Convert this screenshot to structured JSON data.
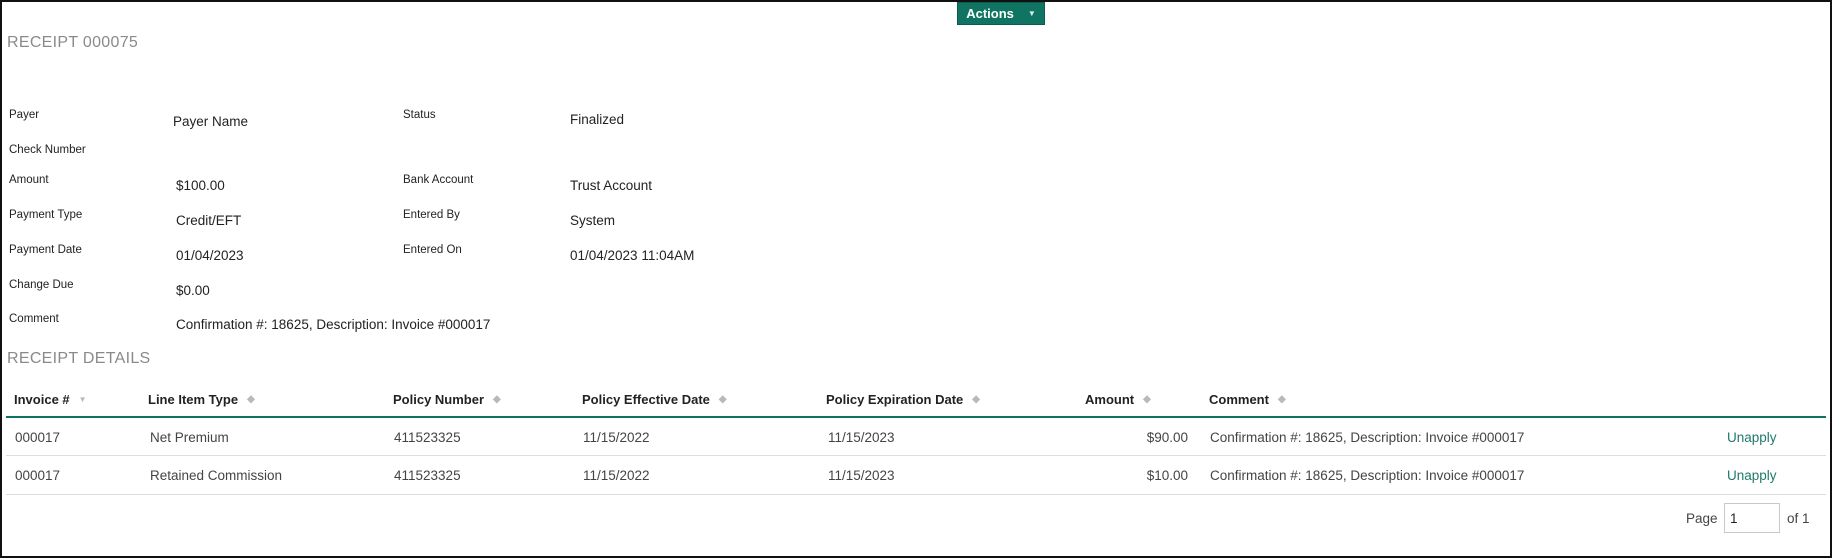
{
  "header": {
    "receipt_title": "RECEIPT 000075",
    "actions_label": "Actions",
    "actions_caret": "▼",
    "accent_color": "#0f7562"
  },
  "fields": {
    "payer_label": "Payer",
    "payer_value": "Payer Name",
    "status_label": "Status",
    "status_value": "Finalized",
    "check_number_label": "Check Number",
    "check_number_value": "",
    "amount_label": "Amount",
    "amount_value": "$100.00",
    "bank_account_label": "Bank Account",
    "bank_account_value": "Trust Account",
    "payment_type_label": "Payment Type",
    "payment_type_value": "Credit/EFT",
    "entered_by_label": "Entered By",
    "entered_by_value": "System",
    "payment_date_label": "Payment Date",
    "payment_date_value": "01/04/2023",
    "entered_on_label": "Entered On",
    "entered_on_value": "01/04/2023 11:04AM",
    "change_due_label": "Change Due",
    "change_due_value": "$0.00",
    "comment_label": "Comment",
    "comment_value": "Confirmation #: 18625, Description: Invoice #000017"
  },
  "details": {
    "section_title": "RECEIPT DETAILS",
    "columns": [
      {
        "label": "Invoice #",
        "sort_icon": "▼"
      },
      {
        "label": "Line Item Type",
        "sort_icon": "◆"
      },
      {
        "label": "Policy Number",
        "sort_icon": "◆"
      },
      {
        "label": "Policy Effective Date",
        "sort_icon": "◆"
      },
      {
        "label": "Policy Expiration Date",
        "sort_icon": "◆"
      },
      {
        "label": "Amount",
        "sort_icon": "◆"
      },
      {
        "label": "Comment",
        "sort_icon": "◆"
      }
    ],
    "rows": [
      {
        "invoice": "000017",
        "line_item_type": "Net Premium",
        "policy_number": "411523325",
        "effective_date": "11/15/2022",
        "expiration_date": "11/15/2023",
        "amount": "$90.00",
        "comment": "Confirmation #: 18625, Description: Invoice #000017",
        "action": "Unapply"
      },
      {
        "invoice": "000017",
        "line_item_type": "Retained Commission",
        "policy_number": "411523325",
        "effective_date": "11/15/2022",
        "expiration_date": "11/15/2023",
        "amount": "$10.00",
        "comment": "Confirmation #: 18625, Description: Invoice #000017",
        "action": "Unapply"
      }
    ]
  },
  "pager": {
    "page_label": "Page",
    "page_value": "1",
    "of_label": "of 1"
  }
}
